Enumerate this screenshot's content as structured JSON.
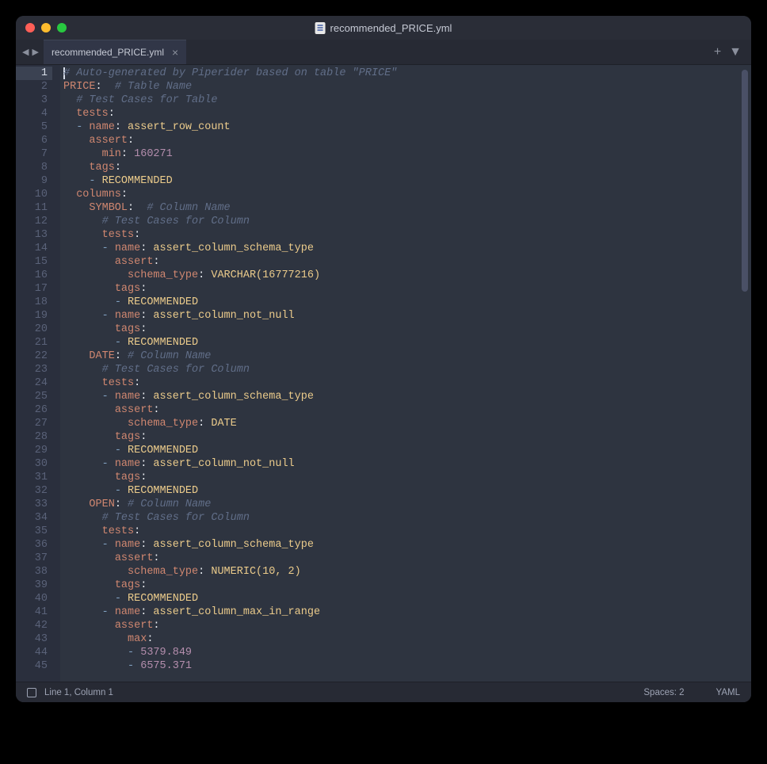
{
  "window": {
    "title": "recommended_PRICE.yml"
  },
  "tab": {
    "label": "recommended_PRICE.yml"
  },
  "statusbar": {
    "cursor": "Line 1, Column 1",
    "spaces": "Spaces: 2",
    "lang": "YAML"
  },
  "lines": [
    [
      [
        "cursor",
        ""
      ],
      [
        "comment",
        "# Auto-generated by Piperider based on table \"PRICE\""
      ]
    ],
    [
      [
        "key",
        "PRICE"
      ],
      [
        "punc",
        ":"
      ],
      [
        "plain",
        "  "
      ],
      [
        "comment",
        "# Table Name"
      ]
    ],
    [
      [
        "plain",
        "  "
      ],
      [
        "comment",
        "# Test Cases for Table"
      ]
    ],
    [
      [
        "plain",
        "  "
      ],
      [
        "key",
        "tests"
      ],
      [
        "punc",
        ":"
      ]
    ],
    [
      [
        "plain",
        "  "
      ],
      [
        "dash",
        "- "
      ],
      [
        "key",
        "name"
      ],
      [
        "punc",
        ": "
      ],
      [
        "string",
        "assert_row_count"
      ]
    ],
    [
      [
        "plain",
        "    "
      ],
      [
        "key",
        "assert"
      ],
      [
        "punc",
        ":"
      ]
    ],
    [
      [
        "plain",
        "      "
      ],
      [
        "key",
        "min"
      ],
      [
        "punc",
        ": "
      ],
      [
        "num",
        "160271"
      ]
    ],
    [
      [
        "plain",
        "    "
      ],
      [
        "key",
        "tags"
      ],
      [
        "punc",
        ":"
      ]
    ],
    [
      [
        "plain",
        "    "
      ],
      [
        "dash",
        "- "
      ],
      [
        "string",
        "RECOMMENDED"
      ]
    ],
    [
      [
        "plain",
        "  "
      ],
      [
        "key",
        "columns"
      ],
      [
        "punc",
        ":"
      ]
    ],
    [
      [
        "plain",
        "    "
      ],
      [
        "key",
        "SYMBOL"
      ],
      [
        "punc",
        ":"
      ],
      [
        "plain",
        "  "
      ],
      [
        "comment",
        "# Column Name"
      ]
    ],
    [
      [
        "plain",
        "      "
      ],
      [
        "comment",
        "# Test Cases for Column"
      ]
    ],
    [
      [
        "plain",
        "      "
      ],
      [
        "key",
        "tests"
      ],
      [
        "punc",
        ":"
      ]
    ],
    [
      [
        "plain",
        "      "
      ],
      [
        "dash",
        "- "
      ],
      [
        "key",
        "name"
      ],
      [
        "punc",
        ": "
      ],
      [
        "string",
        "assert_column_schema_type"
      ]
    ],
    [
      [
        "plain",
        "        "
      ],
      [
        "key",
        "assert"
      ],
      [
        "punc",
        ":"
      ]
    ],
    [
      [
        "plain",
        "          "
      ],
      [
        "key",
        "schema_type"
      ],
      [
        "punc",
        ": "
      ],
      [
        "string",
        "VARCHAR(16777216)"
      ]
    ],
    [
      [
        "plain",
        "        "
      ],
      [
        "key",
        "tags"
      ],
      [
        "punc",
        ":"
      ]
    ],
    [
      [
        "plain",
        "        "
      ],
      [
        "dash",
        "- "
      ],
      [
        "string",
        "RECOMMENDED"
      ]
    ],
    [
      [
        "plain",
        "      "
      ],
      [
        "dash",
        "- "
      ],
      [
        "key",
        "name"
      ],
      [
        "punc",
        ": "
      ],
      [
        "string",
        "assert_column_not_null"
      ]
    ],
    [
      [
        "plain",
        "        "
      ],
      [
        "key",
        "tags"
      ],
      [
        "punc",
        ":"
      ]
    ],
    [
      [
        "plain",
        "        "
      ],
      [
        "dash",
        "- "
      ],
      [
        "string",
        "RECOMMENDED"
      ]
    ],
    [
      [
        "plain",
        "    "
      ],
      [
        "key",
        "DATE"
      ],
      [
        "punc",
        ": "
      ],
      [
        "comment",
        "# Column Name"
      ]
    ],
    [
      [
        "plain",
        "      "
      ],
      [
        "comment",
        "# Test Cases for Column"
      ]
    ],
    [
      [
        "plain",
        "      "
      ],
      [
        "key",
        "tests"
      ],
      [
        "punc",
        ":"
      ]
    ],
    [
      [
        "plain",
        "      "
      ],
      [
        "dash",
        "- "
      ],
      [
        "key",
        "name"
      ],
      [
        "punc",
        ": "
      ],
      [
        "string",
        "assert_column_schema_type"
      ]
    ],
    [
      [
        "plain",
        "        "
      ],
      [
        "key",
        "assert"
      ],
      [
        "punc",
        ":"
      ]
    ],
    [
      [
        "plain",
        "          "
      ],
      [
        "key",
        "schema_type"
      ],
      [
        "punc",
        ": "
      ],
      [
        "string",
        "DATE"
      ]
    ],
    [
      [
        "plain",
        "        "
      ],
      [
        "key",
        "tags"
      ],
      [
        "punc",
        ":"
      ]
    ],
    [
      [
        "plain",
        "        "
      ],
      [
        "dash",
        "- "
      ],
      [
        "string",
        "RECOMMENDED"
      ]
    ],
    [
      [
        "plain",
        "      "
      ],
      [
        "dash",
        "- "
      ],
      [
        "key",
        "name"
      ],
      [
        "punc",
        ": "
      ],
      [
        "string",
        "assert_column_not_null"
      ]
    ],
    [
      [
        "plain",
        "        "
      ],
      [
        "key",
        "tags"
      ],
      [
        "punc",
        ":"
      ]
    ],
    [
      [
        "plain",
        "        "
      ],
      [
        "dash",
        "- "
      ],
      [
        "string",
        "RECOMMENDED"
      ]
    ],
    [
      [
        "plain",
        "    "
      ],
      [
        "key",
        "OPEN"
      ],
      [
        "punc",
        ": "
      ],
      [
        "comment",
        "# Column Name"
      ]
    ],
    [
      [
        "plain",
        "      "
      ],
      [
        "comment",
        "# Test Cases for Column"
      ]
    ],
    [
      [
        "plain",
        "      "
      ],
      [
        "key",
        "tests"
      ],
      [
        "punc",
        ":"
      ]
    ],
    [
      [
        "plain",
        "      "
      ],
      [
        "dash",
        "- "
      ],
      [
        "key",
        "name"
      ],
      [
        "punc",
        ": "
      ],
      [
        "string",
        "assert_column_schema_type"
      ]
    ],
    [
      [
        "plain",
        "        "
      ],
      [
        "key",
        "assert"
      ],
      [
        "punc",
        ":"
      ]
    ],
    [
      [
        "plain",
        "          "
      ],
      [
        "key",
        "schema_type"
      ],
      [
        "punc",
        ": "
      ],
      [
        "string",
        "NUMERIC(10, 2)"
      ]
    ],
    [
      [
        "plain",
        "        "
      ],
      [
        "key",
        "tags"
      ],
      [
        "punc",
        ":"
      ]
    ],
    [
      [
        "plain",
        "        "
      ],
      [
        "dash",
        "- "
      ],
      [
        "string",
        "RECOMMENDED"
      ]
    ],
    [
      [
        "plain",
        "      "
      ],
      [
        "dash",
        "- "
      ],
      [
        "key",
        "name"
      ],
      [
        "punc",
        ": "
      ],
      [
        "string",
        "assert_column_max_in_range"
      ]
    ],
    [
      [
        "plain",
        "        "
      ],
      [
        "key",
        "assert"
      ],
      [
        "punc",
        ":"
      ]
    ],
    [
      [
        "plain",
        "          "
      ],
      [
        "key",
        "max"
      ],
      [
        "punc",
        ":"
      ]
    ],
    [
      [
        "plain",
        "          "
      ],
      [
        "dash",
        "- "
      ],
      [
        "num",
        "5379.849"
      ]
    ],
    [
      [
        "plain",
        "          "
      ],
      [
        "dash",
        "- "
      ],
      [
        "num",
        "6575.371"
      ]
    ]
  ]
}
